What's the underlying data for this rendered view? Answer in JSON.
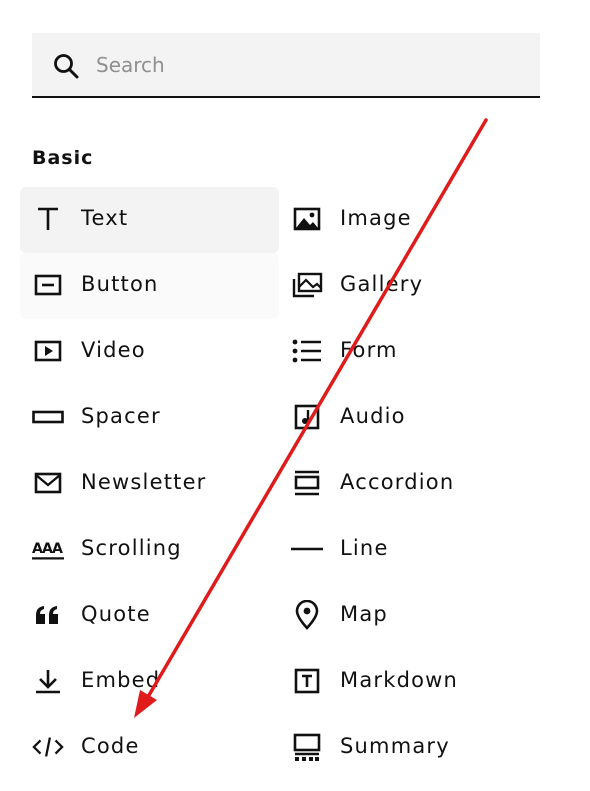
{
  "search": {
    "placeholder": "Search",
    "value": ""
  },
  "section_title": "Basic",
  "blocks": [
    {
      "label": "Text",
      "icon": "text-icon"
    },
    {
      "label": "Image",
      "icon": "image-icon"
    },
    {
      "label": "Button",
      "icon": "button-icon"
    },
    {
      "label": "Gallery",
      "icon": "gallery-icon"
    },
    {
      "label": "Video",
      "icon": "video-icon"
    },
    {
      "label": "Form",
      "icon": "form-icon"
    },
    {
      "label": "Spacer",
      "icon": "spacer-icon"
    },
    {
      "label": "Audio",
      "icon": "audio-icon"
    },
    {
      "label": "Newsletter",
      "icon": "newsletter-icon"
    },
    {
      "label": "Accordion",
      "icon": "accordion-icon"
    },
    {
      "label": "Scrolling",
      "icon": "scrolling-icon"
    },
    {
      "label": "Line",
      "icon": "line-icon"
    },
    {
      "label": "Quote",
      "icon": "quote-icon"
    },
    {
      "label": "Map",
      "icon": "map-pin-icon"
    },
    {
      "label": "Embed",
      "icon": "embed-icon"
    },
    {
      "label": "Markdown",
      "icon": "markdown-icon"
    },
    {
      "label": "Code",
      "icon": "code-icon"
    },
    {
      "label": "Summary",
      "icon": "summary-icon"
    }
  ],
  "colors": {
    "accent_arrow": "#e01b1b",
    "panel": "#f3f3f3",
    "text": "#111111",
    "placeholder": "#8f8f8f"
  }
}
